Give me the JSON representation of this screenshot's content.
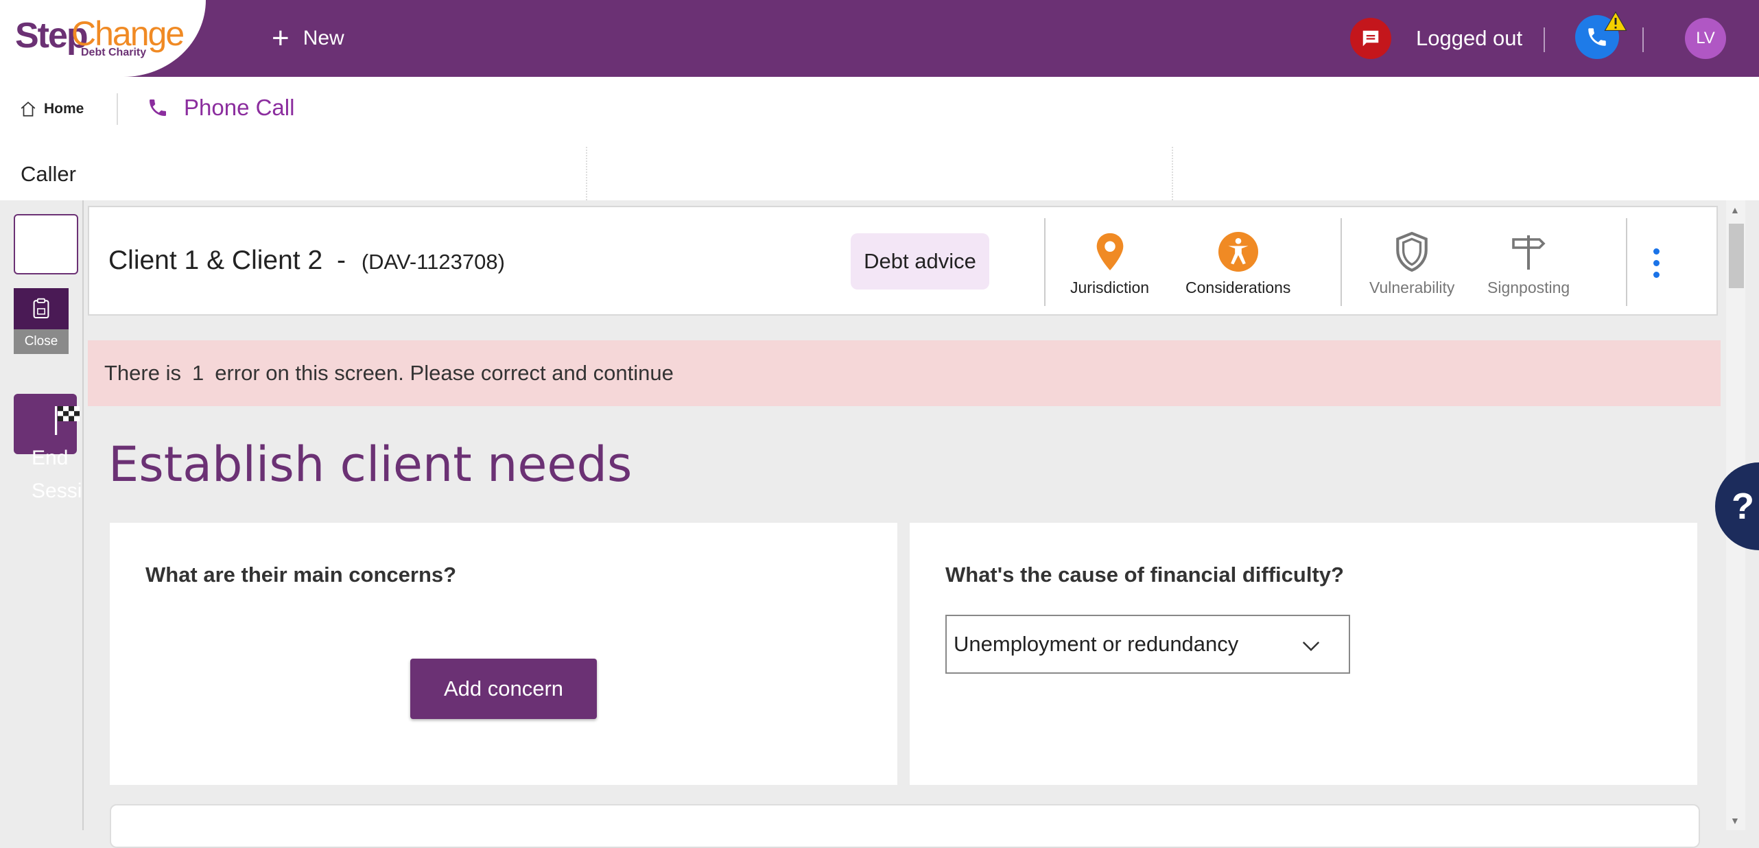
{
  "app": {
    "logo_step": "Step",
    "logo_change": "Change",
    "logo_sub": "Debt Charity",
    "brand_color": "#6b3174"
  },
  "topbar": {
    "new_label": "New",
    "status_text": "Logged out",
    "avatar_initials": "LV"
  },
  "tabs": {
    "home_label": "Home",
    "phone_call_label": "Phone Call"
  },
  "caller": {
    "label": "Caller"
  },
  "rail": {
    "close_label": "Close",
    "end_session_label": "End\nSession"
  },
  "client": {
    "name": "Client 1 & Client 2",
    "separator": "-",
    "reference": "(DAV-1123708)",
    "badge": "Debt advice",
    "icons": [
      {
        "label": "Jurisdiction",
        "icon": "location-pin-icon",
        "color": "#f08a24"
      },
      {
        "label": "Considerations",
        "icon": "accessibility-icon",
        "color": "#f08a24"
      },
      {
        "label": "Vulnerability",
        "icon": "shield-icon",
        "color": "#777777"
      },
      {
        "label": "Signposting",
        "icon": "signpost-icon",
        "color": "#777777"
      }
    ]
  },
  "error": {
    "prefix": "There is",
    "count": "1",
    "suffix": "error on this screen.  Please correct and continue"
  },
  "page": {
    "title": "Establish client needs"
  },
  "concerns": {
    "question": "What are their main concerns?",
    "add_button": "Add concern"
  },
  "cause": {
    "question": "What's the cause of financial difficulty?",
    "selected": "Unemployment or redundancy"
  },
  "help": {
    "label": "?"
  }
}
